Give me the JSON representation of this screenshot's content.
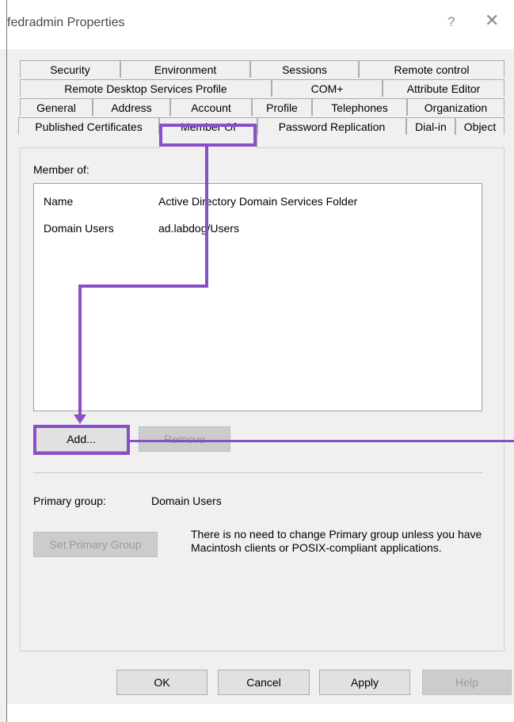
{
  "window": {
    "title": "fedradmin Properties",
    "help_glyph": "?",
    "close_glyph": "✕"
  },
  "tabs": {
    "row1": [
      "Security",
      "Environment",
      "Sessions",
      "Remote control"
    ],
    "row2": [
      "Remote Desktop Services Profile",
      "COM+",
      "Attribute Editor"
    ],
    "row3": [
      "General",
      "Address",
      "Account",
      "Profile",
      "Telephones",
      "Organization"
    ],
    "row4": [
      "Published Certificates",
      "Member Of",
      "Password Replication",
      "Dial-in",
      "Object"
    ],
    "active": "Member Of"
  },
  "member_of": {
    "label": "Member of:",
    "columns": [
      "Name",
      "Active Directory Domain Services Folder"
    ],
    "rows": [
      {
        "name": "Domain Users",
        "folder": "ad.labdog/Users"
      }
    ]
  },
  "buttons": {
    "add": "Add...",
    "remove": "Remove",
    "set_primary": "Set Primary Group"
  },
  "primary_group": {
    "label": "Primary group:",
    "value": "Domain Users",
    "note": "There is no need to change Primary group unless you have Macintosh clients or POSIX-compliant applications."
  },
  "footer": {
    "ok": "OK",
    "cancel": "Cancel",
    "apply": "Apply",
    "help": "Help"
  },
  "colors": {
    "annotation": "#8a4fc7",
    "dialog_bg": "#f0f0f0",
    "button_bg": "#e1e1e1"
  }
}
